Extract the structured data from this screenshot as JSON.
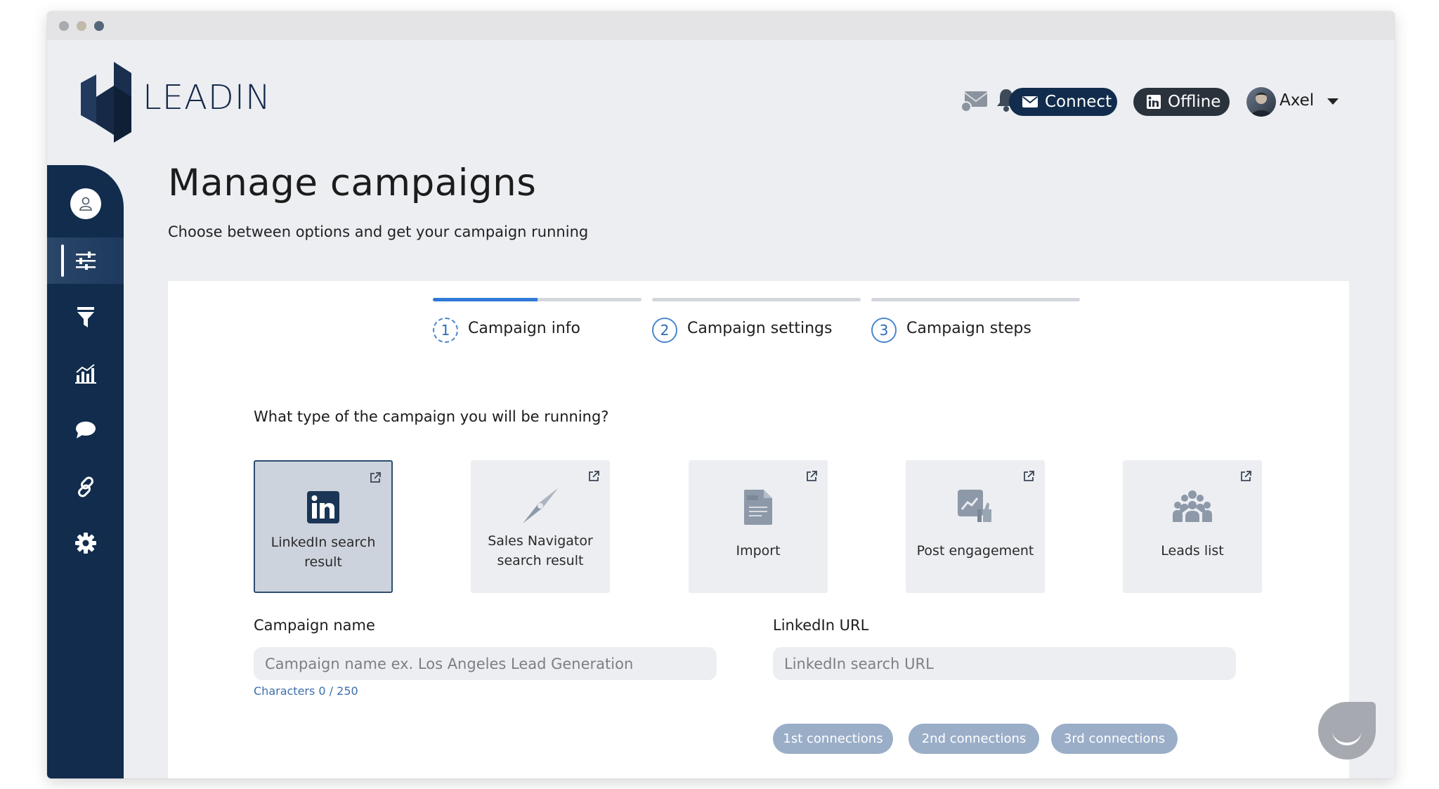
{
  "brand": {
    "name": "LEADIN"
  },
  "header": {
    "connect_label": "Connect",
    "offline_label": "Offline",
    "user_name": "Axel"
  },
  "page": {
    "title": "Manage campaigns",
    "subtitle": "Choose between options and get your campaign running"
  },
  "steps": [
    {
      "number": "1",
      "label": "Campaign info",
      "active": true,
      "progress": 0.5
    },
    {
      "number": "2",
      "label": "Campaign settings",
      "active": false,
      "progress": 0
    },
    {
      "number": "3",
      "label": "Campaign steps",
      "active": false,
      "progress": 0
    }
  ],
  "question": "What type of the campaign you will be running?",
  "campaign_types": [
    {
      "line1": "LinkedIn search",
      "line2": "result",
      "icon": "linkedin-icon",
      "selected": true
    },
    {
      "line1": "Sales Navigator",
      "line2": "search result",
      "icon": "compass-icon",
      "selected": false
    },
    {
      "line1": "Import",
      "line2": "",
      "icon": "csv-file-icon",
      "selected": false
    },
    {
      "line1": "Post engagement",
      "line2": "",
      "icon": "post-engagement-icon",
      "selected": false
    },
    {
      "line1": "Leads list",
      "line2": "",
      "icon": "people-group-icon",
      "selected": false
    }
  ],
  "form": {
    "campaign_name_label": "Campaign name",
    "campaign_name_placeholder": "Campaign name ex. Los Angeles Lead Generation",
    "char_count": "Characters 0 / 250",
    "linkedin_url_label": "LinkedIn URL",
    "linkedin_url_placeholder": "LinkedIn search URL"
  },
  "connection_chips": [
    "1st connections",
    "2nd connections",
    "3rd connections"
  ],
  "sidebar_icons": [
    "user-icon",
    "sliders-icon",
    "funnel-icon",
    "chart-icon",
    "chat-icon",
    "link-icon",
    "gear-icon"
  ],
  "colors": {
    "sidebar": "#112c4c",
    "accent": "#2f78d6",
    "chip": "#9baec8",
    "selected_card_border": "#2e4d70"
  }
}
